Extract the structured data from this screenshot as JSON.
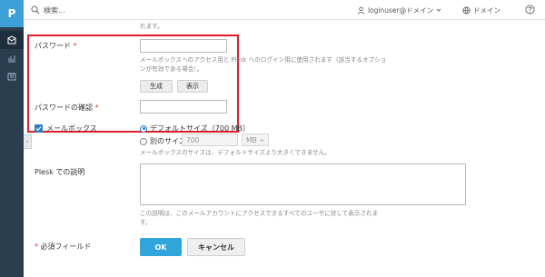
{
  "rail": {
    "logo": "P"
  },
  "topbar": {
    "search_placeholder": "検索...",
    "user_label": "loginuser@ドメイン",
    "domain_label": "ドメイン"
  },
  "form": {
    "top_note": "れます。",
    "password": {
      "label": "パスワード",
      "required_mark": "*",
      "hint_line1": "メールボックスへのアクセス用と Plesk へのログイン用に使用されます（該当するオプショ",
      "hint_line2": "ンが有効である場合）。",
      "generate_label": "生成",
      "show_label": "表示"
    },
    "password_confirm": {
      "label": "パスワードの確認",
      "required_mark": "*"
    },
    "mailbox": {
      "label": "メールボックス",
      "default_size_label": "デフォルトサイズ（700 MB）",
      "custom_size_label": "別のサイズ",
      "custom_size_value": "700",
      "unit_value": "MB",
      "hint": "メールボックスのサイズは、デフォルトサイズより大きくできません。"
    },
    "description": {
      "label": "Plesk での説明",
      "hint_line1": "この説明は、このメールアカウントにアクセスできるすべてのユーザに対して表示されま",
      "hint_line2": "す。"
    },
    "required_legend": {
      "mark": "*",
      "text": "必須フィールド"
    },
    "ok_label": "OK",
    "cancel_label": "キャンセル"
  },
  "colors": {
    "accent": "#2fa5dc",
    "rail_bg": "#2b3e50",
    "highlight": "#e01e27"
  }
}
